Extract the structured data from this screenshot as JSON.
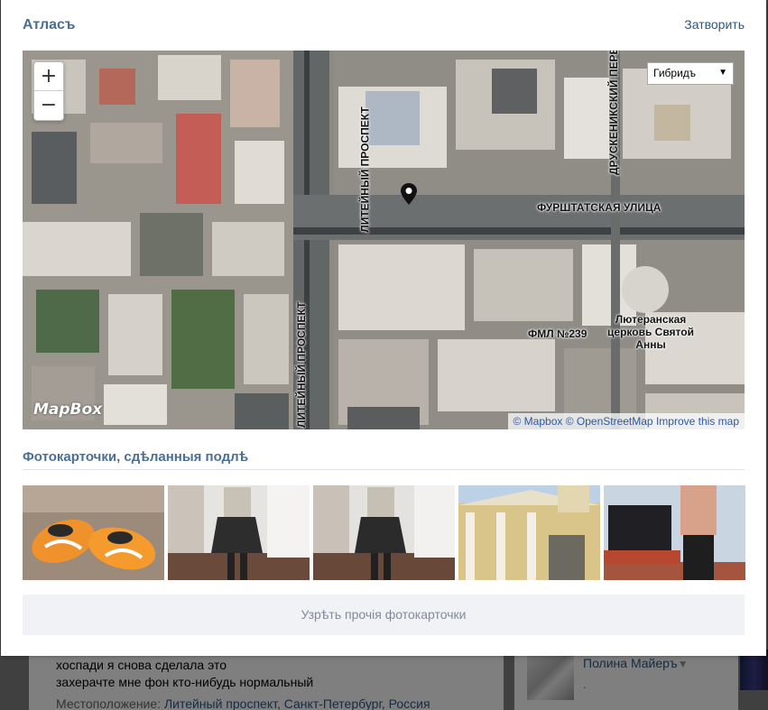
{
  "modal": {
    "title": "Атласъ",
    "close_label": "Затворить"
  },
  "map": {
    "zoom_in": "+",
    "zoom_out": "−",
    "layer_selected": "Гибридъ",
    "labels": {
      "street_main_1": "ЛИТЕЙНЫЙ ПРОСПЕКТ",
      "street_main_2": "ЛИТЕЙНЫЙ ПРОСПЕКТ",
      "street_cross": "ФУРШТАТСКАЯ УЛИЦА",
      "street_right": "ДРУСКЕНИКСКИЙ ПЕРЕУЛ",
      "school": "ФМЛ №239",
      "church": "Лютеранская церковь Святой Анны"
    },
    "logo": "MapBox",
    "attribution": {
      "mapbox": "© Mapbox",
      "osm": "© OpenStreetMap",
      "improve": "Improve this map"
    }
  },
  "photos": {
    "title": "Фотокарточки, сдѣланныя подлѣ",
    "items": [
      {
        "name": "orange-sneakers"
      },
      {
        "name": "mirror-selfie-skirt"
      },
      {
        "name": "mirror-selfie-skirt-2"
      },
      {
        "name": "church-facade"
      },
      {
        "name": "room-tv"
      }
    ],
    "more_label": "Узрѣть прочія фотокарточки"
  },
  "background": {
    "post_line_1": "хоспади я снова сделала это",
    "post_line_2": "захерачте мне фон кто-нибудь нормальный",
    "location_label": "Местоположение:",
    "location_value": "Литейный проспект, Санкт-Петербург, Россия",
    "friend_name": "Полина Майеръ",
    "friend_arrow": "▼",
    "friend_sub": "."
  }
}
